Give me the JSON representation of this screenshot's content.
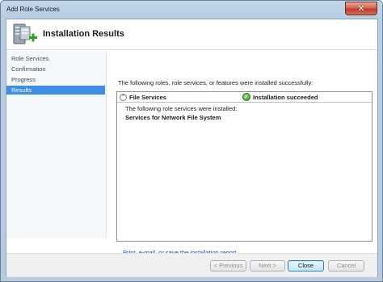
{
  "window": {
    "title": "Add Role Services",
    "close_glyph": "✕"
  },
  "header": {
    "title": "Installation Results",
    "icon": "server-add-role-icon"
  },
  "nav": {
    "items": [
      {
        "label": "Role Services",
        "active": false
      },
      {
        "label": "Confirmation",
        "active": false
      },
      {
        "label": "Progress",
        "active": false
      },
      {
        "label": "Results",
        "active": true
      }
    ]
  },
  "main": {
    "intro": "The following roles, role services, or features were installed successfully:",
    "result": {
      "collapse_glyph": "⌃",
      "name": "File Services",
      "status_icon": "success-check-icon",
      "status_glyph": "✓",
      "status": "Installation succeeded",
      "line1": "The following role services were installed:",
      "line2": "Services for Network File System"
    },
    "report_link": "Print, e-mail, or save the installation report"
  },
  "footer": {
    "previous": "< Previous",
    "next": "Next >",
    "close": "Close",
    "cancel": "Cancel"
  },
  "colors": {
    "accent": "#3d8ee4",
    "link": "#0b52b2",
    "success": "#2c9a1a"
  }
}
